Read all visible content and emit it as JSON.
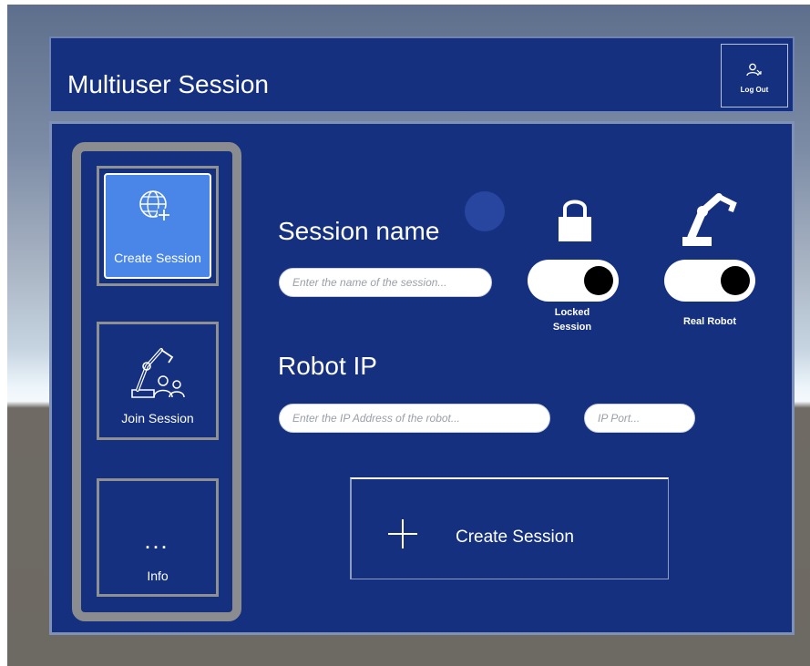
{
  "header": {
    "title": "Multiuser Session",
    "logout_label": "Log Out",
    "logout_icon": "user-logout-icon"
  },
  "sidebar": {
    "items": [
      {
        "label": "Create Session",
        "icon": "globe-plus-icon",
        "active": true
      },
      {
        "label": "Join Session",
        "icon": "robot-arm-users-icon",
        "active": false
      },
      {
        "label": "Info",
        "icon": "dots-icon",
        "glyph": "...",
        "active": false
      }
    ]
  },
  "form": {
    "session_heading": "Session name",
    "session_placeholder": "Enter the name of the session...",
    "robot_ip_heading": "Robot IP",
    "ip_placeholder": "Enter the IP Address of the robot...",
    "port_placeholder": "IP Port..."
  },
  "toggles": {
    "locked": {
      "label_line1": "Locked",
      "label_line2": "Session",
      "icon": "lock-icon",
      "state": "on"
    },
    "real_robot": {
      "label": "Real Robot",
      "icon": "robot-arm-icon",
      "state": "on"
    }
  },
  "create_button": {
    "label": "Create Session",
    "icon": "plus-icon"
  },
  "colors": {
    "panel": "#14307f",
    "accent": "#4a86e8",
    "frame": "#8a8c8f"
  }
}
